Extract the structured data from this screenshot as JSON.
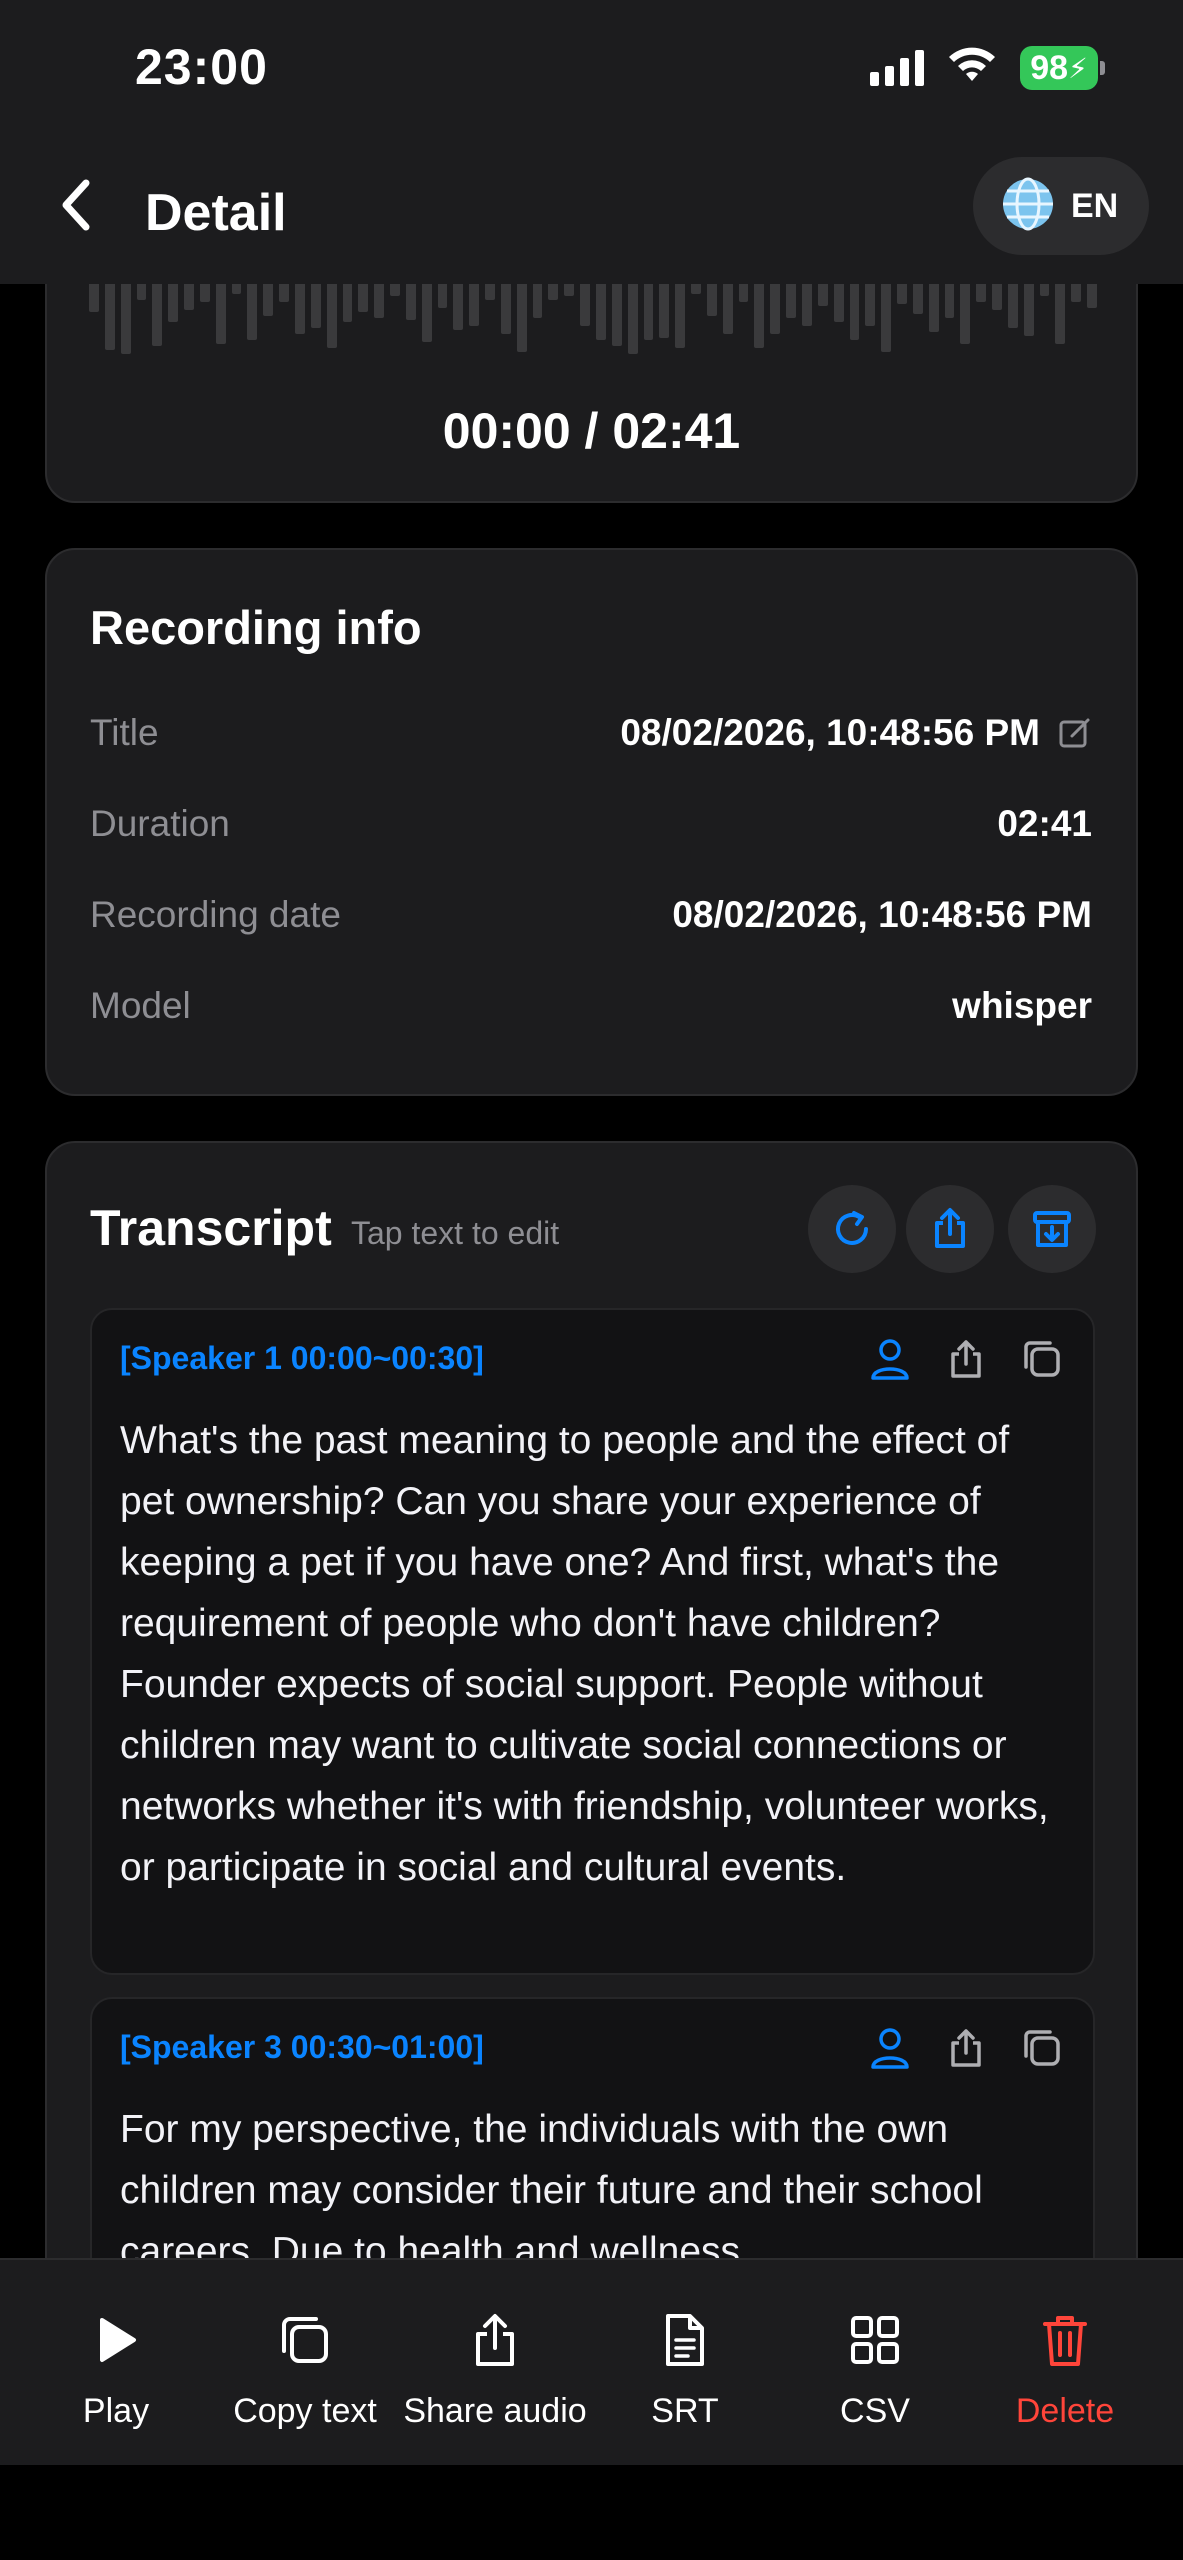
{
  "status_bar": {
    "time": "23:00",
    "battery": "98"
  },
  "header": {
    "title": "Detail",
    "language": "EN"
  },
  "player": {
    "time_display": "00:00 / 02:41"
  },
  "recording_info": {
    "heading": "Recording info",
    "rows": [
      {
        "label": "Title",
        "value": "08/02/2026, 10:48:56 PM"
      },
      {
        "label": "Duration",
        "value": "02:41"
      },
      {
        "label": "Recording date",
        "value": "08/02/2026, 10:48:56 PM"
      },
      {
        "label": "Model",
        "value": "whisper"
      }
    ]
  },
  "transcript": {
    "heading": "Transcript",
    "hint": "Tap text to edit",
    "segments": [
      {
        "header": "[Speaker 1 00:00~00:30]",
        "text": "What's the past meaning to people and the effect of pet ownership? Can you share your experience of keeping a pet if you have one? And first, what's the requirement of people who don't have children? Founder expects of social support. People without children may want to cultivate social connections or networks whether it's with friendship, volunteer works, or participate in social and cultural events."
      },
      {
        "header": "[Speaker 3 00:30~01:00]",
        "text": "For my perspective, the individuals with the own children may consider their future and their school careers. Due to health and wellness"
      }
    ]
  },
  "toolbar": {
    "play": "Play",
    "copy_text": "Copy text",
    "share_audio": "Share audio",
    "srt": "SRT",
    "csv": "CSV",
    "delete": "Delete"
  },
  "colors": {
    "accent": "#0a84ff",
    "danger": "#ff453a",
    "battery": "#34c759",
    "card": "#1c1c1e"
  }
}
